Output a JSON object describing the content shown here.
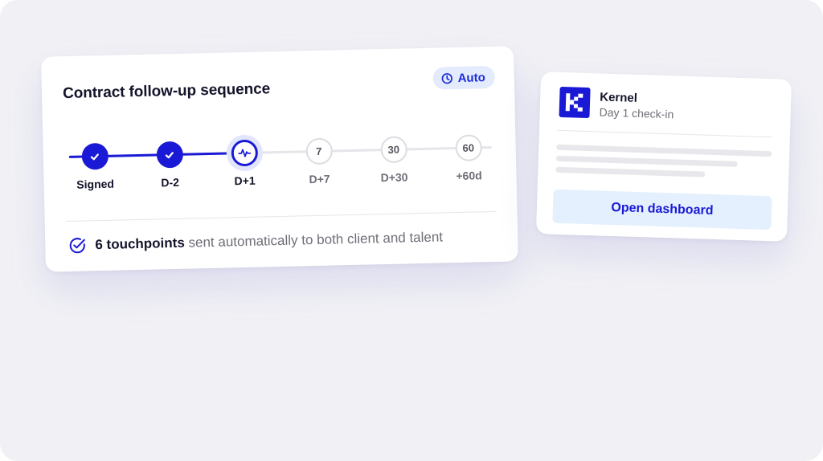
{
  "sequence_card": {
    "title": "Contract follow-up sequence",
    "badge": {
      "label": "Auto",
      "icon": "clock-icon"
    },
    "steps": [
      {
        "label": "Signed",
        "state": "done",
        "marker": "check-icon"
      },
      {
        "label": "D-2",
        "state": "done",
        "marker": "check-icon"
      },
      {
        "label": "D+1",
        "state": "current",
        "marker": "activity-pulse-icon"
      },
      {
        "label": "D+7",
        "state": "pending",
        "marker": "7"
      },
      {
        "label": "D+30",
        "state": "pending",
        "marker": "30"
      },
      {
        "label": "+60d",
        "state": "pending",
        "marker": "60"
      }
    ],
    "footer": {
      "icon": "check-circle-icon",
      "highlight": "6 touchpoints",
      "text": "sent automatically to both client and talent"
    }
  },
  "client_card": {
    "logo_icon": "k-logo-icon",
    "name": "Kernel",
    "subtitle": "Day 1 check-in",
    "button_label": "Open dashboard"
  },
  "colors": {
    "accent": "#1a1ad6",
    "badge_bg": "#e4ebfd",
    "button_bg": "#e4f0fd",
    "background": "#f1f1f5",
    "text_dark": "#14142b",
    "text_muted": "#6e6e78"
  }
}
